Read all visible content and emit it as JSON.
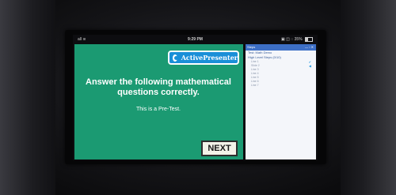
{
  "statusbar": {
    "signal": "all ≋",
    "time": "9:29 PM",
    "battery": "▣ ◫ ◌ 35%"
  },
  "slide": {
    "logo_text": "ActivePresenter",
    "headline_line1": "Answer the following mathematical",
    "headline_line2": "questions correctly.",
    "subline": "This is a Pre-Test.",
    "next_label": "NEXT",
    "background_color": "#1b9a72"
  },
  "steps_panel": {
    "title": "Steps",
    "controls": "— ▫ ✕",
    "line1": "Test: Math Demo",
    "line2": "High Level Steps (0/10)",
    "items": [
      "Line 1",
      "Slide 2",
      "Line 3",
      "Line 4",
      "Line 5",
      "Line 6",
      "Line 7"
    ]
  }
}
